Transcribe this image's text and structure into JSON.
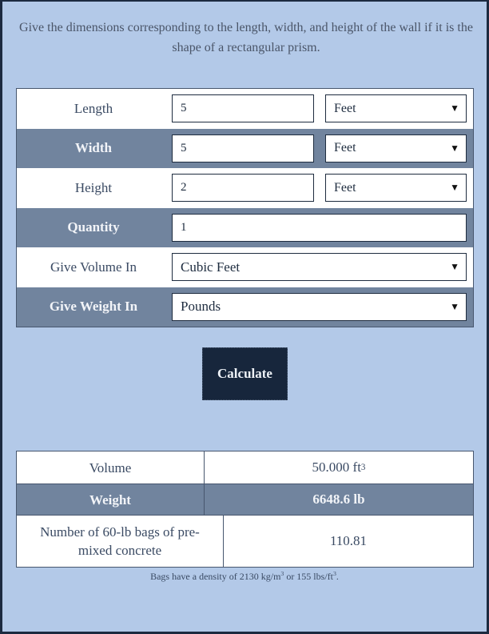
{
  "intro": {
    "text": "Give the dimensions corresponding to the length, width, and height of the wall if it is the shape of a rectangular prism."
  },
  "form": {
    "length": {
      "label": "Length",
      "value": "5",
      "unit": "Feet"
    },
    "width": {
      "label": "Width",
      "value": "5",
      "unit": "Feet"
    },
    "height": {
      "label": "Height",
      "value": "2",
      "unit": "Feet"
    },
    "quantity": {
      "label": "Quantity",
      "value": "1"
    },
    "volume_unit": {
      "label": "Give Volume In",
      "value": "Cubic Feet"
    },
    "weight_unit": {
      "label": "Give Weight In",
      "value": "Pounds"
    }
  },
  "calculate_label": "Calculate",
  "results": {
    "volume": {
      "label": "Volume",
      "value": "50.000 ft",
      "sup": "3"
    },
    "weight": {
      "label": "Weight",
      "value": "6648.6 lb"
    },
    "bags": {
      "label": "Number of 60-lb bags of pre-mixed concrete",
      "value": "110.81"
    }
  },
  "note": {
    "prefix": "Bags have a density of 2130 kg/m",
    "sup1": "3",
    "middle": " or 155 lbs/ft",
    "sup2": "3",
    "suffix": "."
  },
  "icons": {
    "dropdown": "▼"
  },
  "colors": {
    "background": "#b3c9e8",
    "alt_row": "#71849e",
    "button": "#17263c",
    "frame": "#1c2a40"
  }
}
